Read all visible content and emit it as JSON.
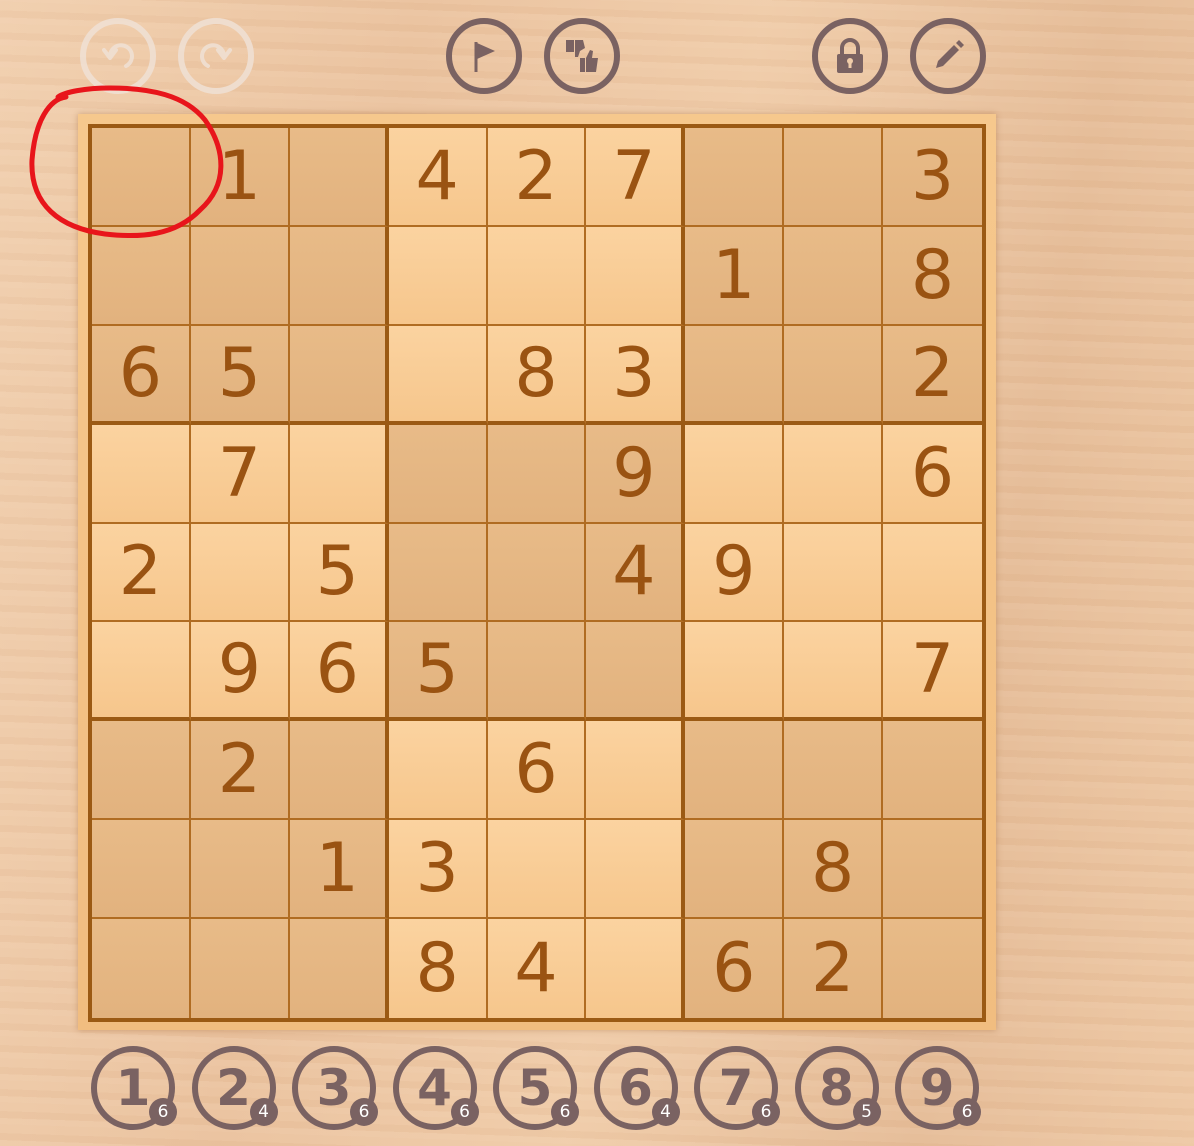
{
  "toolbar": {
    "undo": {
      "icon": "undo-icon",
      "enabled": false
    },
    "redo": {
      "icon": "redo-icon",
      "enabled": false
    },
    "flag": {
      "icon": "flag-icon"
    },
    "rate": {
      "icon": "thumbs-icon"
    },
    "lock": {
      "icon": "lock-icon"
    },
    "pencil": {
      "icon": "pencil-icon"
    }
  },
  "grid": [
    [
      "",
      "1",
      "",
      "4",
      "2",
      "7",
      "",
      "",
      "3"
    ],
    [
      "",
      "",
      "",
      "",
      "",
      "",
      "1",
      "",
      "8"
    ],
    [
      "6",
      "5",
      "",
      "",
      "8",
      "3",
      "",
      "",
      "2"
    ],
    [
      "",
      "7",
      "",
      "",
      "",
      "9",
      "",
      "",
      "6"
    ],
    [
      "2",
      "",
      "5",
      "",
      "",
      "4",
      "9",
      "",
      ""
    ],
    [
      "",
      "9",
      "6",
      "5",
      "",
      "",
      "",
      "",
      "7"
    ],
    [
      "",
      "2",
      "",
      "",
      "6",
      "",
      "",
      "",
      ""
    ],
    [
      "",
      "",
      "1",
      "3",
      "",
      "",
      "",
      "8",
      ""
    ],
    [
      "",
      "",
      "",
      "8",
      "4",
      "",
      "6",
      "2",
      ""
    ]
  ],
  "number_pad": [
    {
      "digit": "1",
      "remaining": "6"
    },
    {
      "digit": "2",
      "remaining": "4"
    },
    {
      "digit": "3",
      "remaining": "6"
    },
    {
      "digit": "4",
      "remaining": "6"
    },
    {
      "digit": "5",
      "remaining": "6"
    },
    {
      "digit": "6",
      "remaining": "4"
    },
    {
      "digit": "7",
      "remaining": "6"
    },
    {
      "digit": "8",
      "remaining": "5"
    },
    {
      "digit": "9",
      "remaining": "6"
    }
  ],
  "colors": {
    "digit": "#9a5312",
    "grid_line": "#9b5a14",
    "button": "#7a6262",
    "annotation": "#e8151b"
  }
}
